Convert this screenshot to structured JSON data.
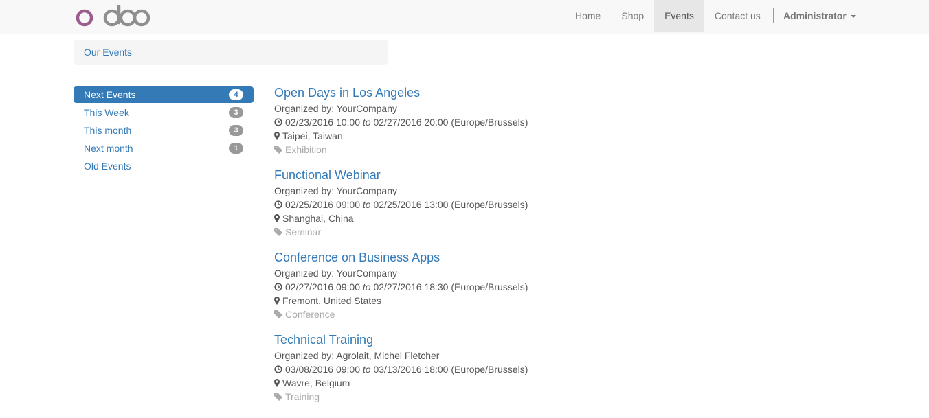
{
  "brand": {
    "logo_text": "odoo",
    "colors": {
      "purple": "#9b5c8f",
      "gray": "#8f8f8f"
    }
  },
  "nav": {
    "items": [
      {
        "label": "Home",
        "active": false
      },
      {
        "label": "Shop",
        "active": false
      },
      {
        "label": "Events",
        "active": true
      },
      {
        "label": "Contact us",
        "active": false
      }
    ],
    "user": "Administrator"
  },
  "breadcrumb": {
    "label": "Our Events"
  },
  "sidebar": {
    "items": [
      {
        "label": "Next Events",
        "count": "4",
        "active": true
      },
      {
        "label": "This Week",
        "count": "3",
        "active": false
      },
      {
        "label": "This month",
        "count": "3",
        "active": false
      },
      {
        "label": "Next month",
        "count": "1",
        "active": false
      },
      {
        "label": "Old Events",
        "count": "",
        "active": false
      }
    ]
  },
  "events": [
    {
      "title": "Open Days in Los Angeles",
      "organizer": "Organized by: YourCompany",
      "start": "02/23/2016 10:00",
      "to": "to",
      "end": "02/27/2016 20:00 (Europe/Brussels)",
      "location": "Taipei, Taiwan",
      "tag": "Exhibition"
    },
    {
      "title": "Functional Webinar",
      "organizer": "Organized by: YourCompany",
      "start": "02/25/2016 09:00",
      "to": "to",
      "end": "02/25/2016 13:00 (Europe/Brussels)",
      "location": "Shanghai, China",
      "tag": "Seminar"
    },
    {
      "title": "Conference on Business Apps",
      "organizer": "Organized by: YourCompany",
      "start": "02/27/2016 09:00",
      "to": "to",
      "end": "02/27/2016 18:30 (Europe/Brussels)",
      "location": "Fremont, United States",
      "tag": "Conference"
    },
    {
      "title": "Technical Training",
      "organizer": "Organized by: Agrolait, Michel Fletcher",
      "start": "03/08/2016 09:00",
      "to": "to",
      "end": "03/13/2016 18:00 (Europe/Brussels)",
      "location": "Wavre, Belgium",
      "tag": "Training"
    }
  ],
  "icons": {
    "clock": "clock-icon",
    "location": "map-marker-icon",
    "tag": "tag-icon",
    "caret": "caret-down-icon"
  }
}
